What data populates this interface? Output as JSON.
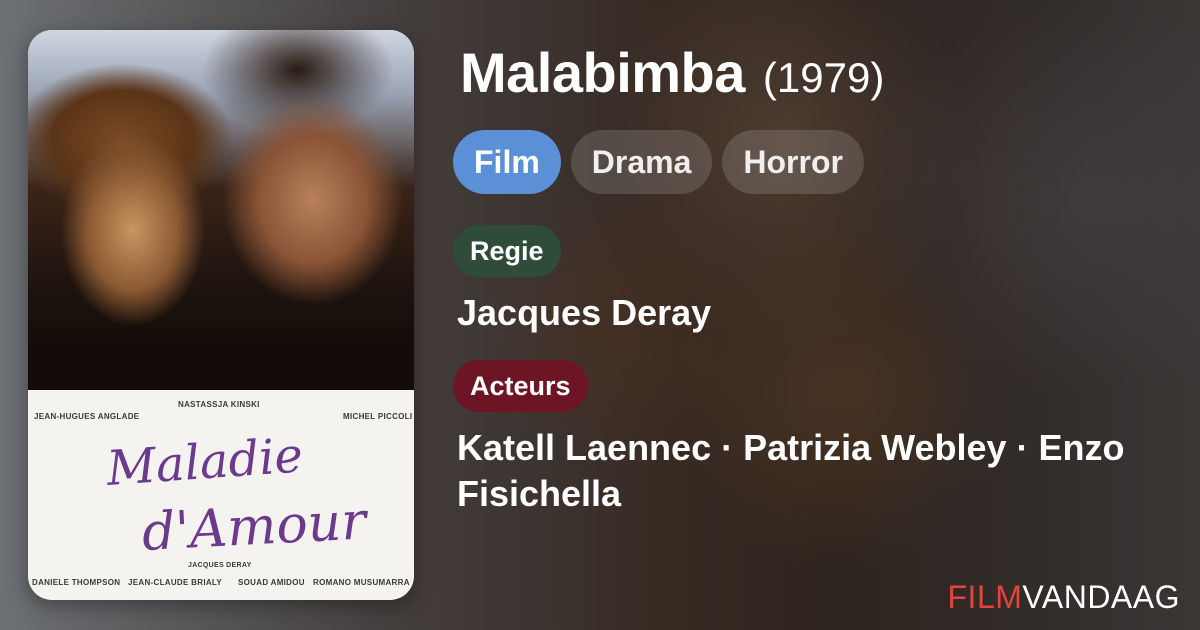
{
  "movie": {
    "title": "Malabimba",
    "year": "(1979)"
  },
  "genres": [
    "Film",
    "Drama",
    "Horror"
  ],
  "director": {
    "label": "Regie",
    "names": "Jacques Deray"
  },
  "actors": {
    "label": "Acteurs",
    "names": "Katell Laennec · Patrizia Webley · Enzo Fisichella"
  },
  "brand": {
    "part1": "FILM",
    "part2": "VANDAAG",
    "colors": {
      "film": "#e2453a",
      "vandaag": "#ffffff"
    }
  },
  "poster": {
    "credits_top": [
      "JEAN-HUGUES ANGLADE",
      "NASTASSJA KINSKI",
      "MICHEL PICCOLI"
    ],
    "title_line1": "Maladie",
    "title_line2": "d'Amour",
    "director_credit": "JACQUES DERAY",
    "credits_bottom": [
      "DANIELE THOMPSON",
      "JEAN-CLAUDE BRIALY",
      "SOUAD AMIDOU",
      "ROMANO MUSUMARRA"
    ]
  },
  "colors": {
    "chip_primary": "#5b8fd6",
    "regie_badge": "#2f4c38",
    "acteurs_badge": "#6d1525"
  }
}
